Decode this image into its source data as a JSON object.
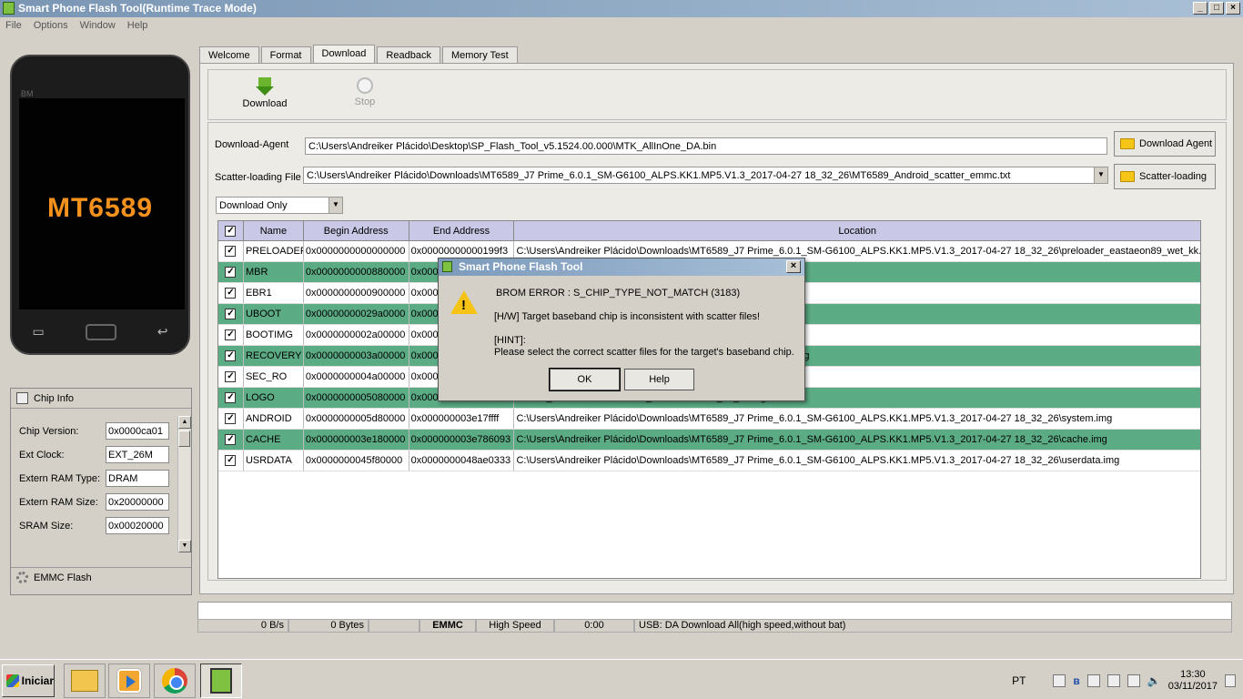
{
  "window": {
    "title": "Smart Phone Flash Tool(Runtime Trace Mode)",
    "controls": [
      "_",
      "□",
      "×"
    ]
  },
  "menu": [
    "File",
    "Options",
    "Window",
    "Help"
  ],
  "phone": {
    "brand": "BM",
    "chip": "MT6589"
  },
  "chip_info": {
    "title": "Chip Info",
    "rows": [
      {
        "label": "Chip Version:",
        "value": "0x0000ca01"
      },
      {
        "label": "Ext Clock:",
        "value": "EXT_26M"
      },
      {
        "label": "Extern RAM Type:",
        "value": "DRAM"
      },
      {
        "label": "Extern RAM Size:",
        "value": "0x20000000"
      },
      {
        "label": "SRAM Size:",
        "value": "0x00020000"
      }
    ],
    "emmc": "EMMC Flash"
  },
  "tabs": [
    "Welcome",
    "Format",
    "Download",
    "Readback",
    "Memory Test"
  ],
  "active_tab": "Download",
  "toolbar": {
    "download": "Download",
    "stop": "Stop"
  },
  "download_agent": {
    "label": "Download-Agent",
    "value": "C:\\Users\\Andreiker Plácido\\Desktop\\SP_Flash_Tool_v5.1524.00.000\\MTK_AllInOne_DA.bin",
    "button": "Download Agent"
  },
  "scatter": {
    "label": "Scatter-loading File",
    "value": "C:\\Users\\Andreiker Plácido\\Downloads\\MT6589_J7 Prime_6.0.1_SM-G6100_ALPS.KK1.MP5.V1.3_2017-04-27 18_32_26\\MT6589_Android_scatter_emmc.txt",
    "button": "Scatter-loading"
  },
  "mode": "Download Only",
  "table": {
    "headers": [
      "",
      "Name",
      "Begin Address",
      "End Address",
      "Location"
    ],
    "rows": [
      {
        "checked": true,
        "name": "PRELOADER",
        "begin": "0x0000000000000000",
        "end": "0x00000000000199f3",
        "location": "C:\\Users\\Andreiker Plácido\\Downloads\\MT6589_J7 Prime_6.0.1_SM-G6100_ALPS.KK1.MP5.V1.3_2017-04-27 18_32_26\\preloader_eastaeon89_wet_kk.bin",
        "highlight": false
      },
      {
        "checked": true,
        "name": "MBR",
        "begin": "0x0000000000880000",
        "end": "0x000",
        "location": "G6100_ALPS.KK1.MP5.V1.3_2017-04-27 18_32_26\\MBR",
        "highlight": true
      },
      {
        "checked": true,
        "name": "EBR1",
        "begin": "0x0000000000900000",
        "end": "0x000",
        "location": "G6100_ALPS.KK1.MP5.V1.3_2017-04-27 18_32_26\\EBR1",
        "highlight": false
      },
      {
        "checked": true,
        "name": "UBOOT",
        "begin": "0x00000000029a0000",
        "end": "0x000",
        "location": "G6100_ALPS.KK1.MP5.V1.3_2017-04-27 18_32_26\\uboot.bin",
        "highlight": true
      },
      {
        "checked": true,
        "name": "BOOTIMG",
        "begin": "0x0000000002a00000",
        "end": "0x000",
        "location": "G6100_ALPS.KK1.MP5.V1.3_2017-04-27 18_32_26\\boot.img",
        "highlight": false
      },
      {
        "checked": true,
        "name": "RECOVERY",
        "begin": "0x0000000003a00000",
        "end": "0x000",
        "location": "G6100_ALPS.KK1.MP5.V1.3_2017-04-27 18_32_26\\recovery.img",
        "highlight": true
      },
      {
        "checked": true,
        "name": "SEC_RO",
        "begin": "0x0000000004a00000",
        "end": "0x000",
        "location": "G6100_ALPS.KK1.MP5.V1.3_2017-04-27 18_32_26\\secro.img",
        "highlight": false
      },
      {
        "checked": true,
        "name": "LOGO",
        "begin": "0x0000000005080000",
        "end": "0x000",
        "location": "G6100_ALPS.KK1.MP5.V1.3_2017-04-27 18_32_26\\logo.bin",
        "highlight": true
      },
      {
        "checked": true,
        "name": "ANDROID",
        "begin": "0x0000000005d80000",
        "end": "0x000000003e17ffff",
        "location": "C:\\Users\\Andreiker Plácido\\Downloads\\MT6589_J7 Prime_6.0.1_SM-G6100_ALPS.KK1.MP5.V1.3_2017-04-27 18_32_26\\system.img",
        "highlight": false
      },
      {
        "checked": true,
        "name": "CACHE",
        "begin": "0x000000003e180000",
        "end": "0x000000003e786093",
        "location": "C:\\Users\\Andreiker Plácido\\Downloads\\MT6589_J7 Prime_6.0.1_SM-G6100_ALPS.KK1.MP5.V1.3_2017-04-27 18_32_26\\cache.img",
        "highlight": true
      },
      {
        "checked": true,
        "name": "USRDATA",
        "begin": "0x0000000045f80000",
        "end": "0x0000000048ae0333",
        "location": "C:\\Users\\Andreiker Plácido\\Downloads\\MT6589_J7 Prime_6.0.1_SM-G6100_ALPS.KK1.MP5.V1.3_2017-04-27 18_32_26\\userdata.img",
        "highlight": false
      }
    ]
  },
  "status": {
    "speed": "0 B/s",
    "bytes": "0 Bytes",
    "storage": "EMMC",
    "mode": "High Speed",
    "time": "0:00",
    "usb": "USB: DA Download All(high speed,without bat)"
  },
  "dialog": {
    "title": "Smart Phone Flash Tool",
    "error": "BROM ERROR : S_CHIP_TYPE_NOT_MATCH (3183)",
    "hw": "[H/W] Target baseband chip is inconsistent with scatter files!",
    "hint_label": "[HINT]:",
    "hint": "Please select the correct scatter files for the target's baseband chip.",
    "ok": "OK",
    "help": "Help"
  },
  "taskbar": {
    "start": "Iniciar",
    "lang": "PT",
    "time": "13:30",
    "date": "03/11/2017"
  }
}
